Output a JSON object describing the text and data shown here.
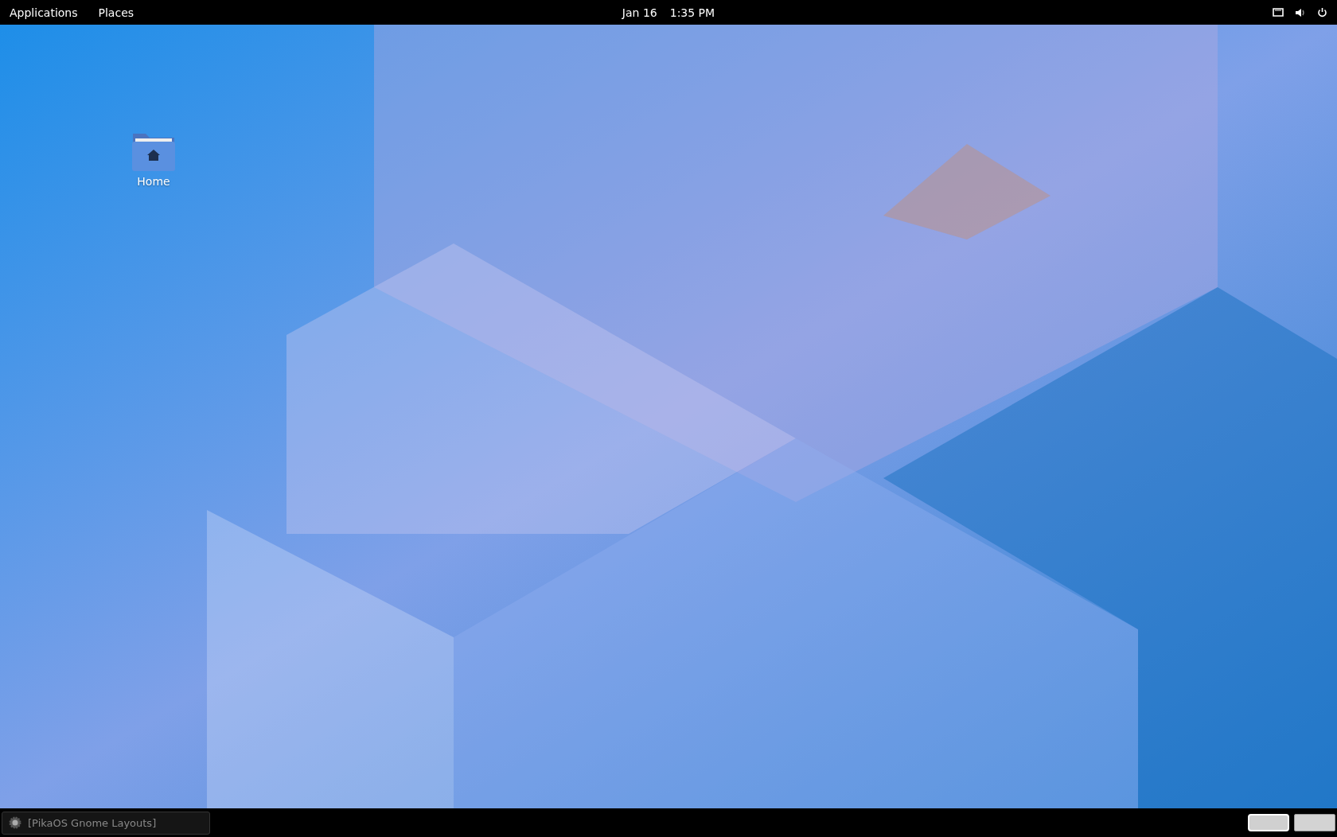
{
  "top_bar": {
    "menus": [
      "Applications",
      "Places"
    ],
    "date": "Jan 16",
    "time": "1:35 PM"
  },
  "desktop_icons": [
    {
      "label": "Home"
    }
  ],
  "taskbar": {
    "window_buttons": [
      {
        "label": "[PikaOS Gnome Layouts]"
      }
    ],
    "workspaces": [
      {
        "selected": true
      },
      {
        "selected": false
      }
    ]
  }
}
